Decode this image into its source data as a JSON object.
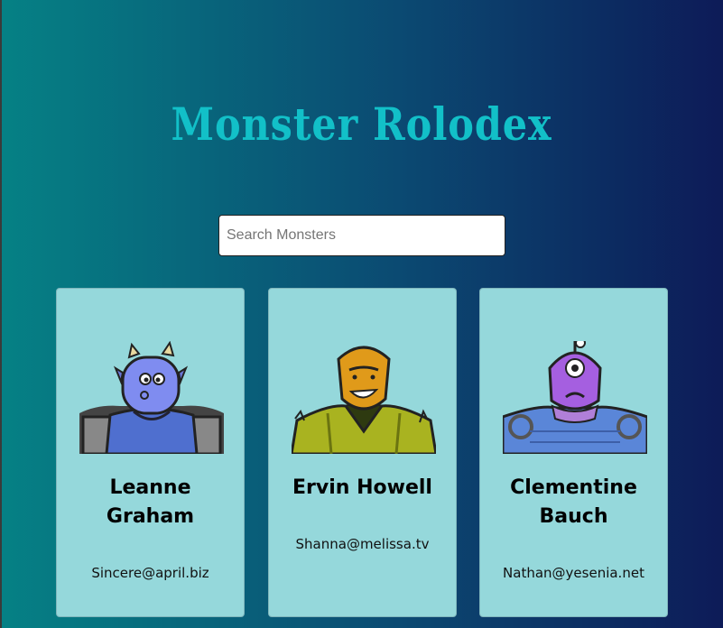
{
  "app": {
    "title": "Monster Rolodex"
  },
  "search": {
    "placeholder": "Search Monsters",
    "value": ""
  },
  "monsters": [
    {
      "name": "Leanne Graham",
      "email": "Sincere@april.biz",
      "avatar": "blue-horned-monster"
    },
    {
      "name": "Ervin Howell",
      "email": "Shanna@melissa.tv",
      "avatar": "orange-grinning-monster"
    },
    {
      "name": "Clementine Bauch",
      "email": "Nathan@yesenia.net",
      "avatar": "purple-cyclops-monster"
    }
  ]
}
